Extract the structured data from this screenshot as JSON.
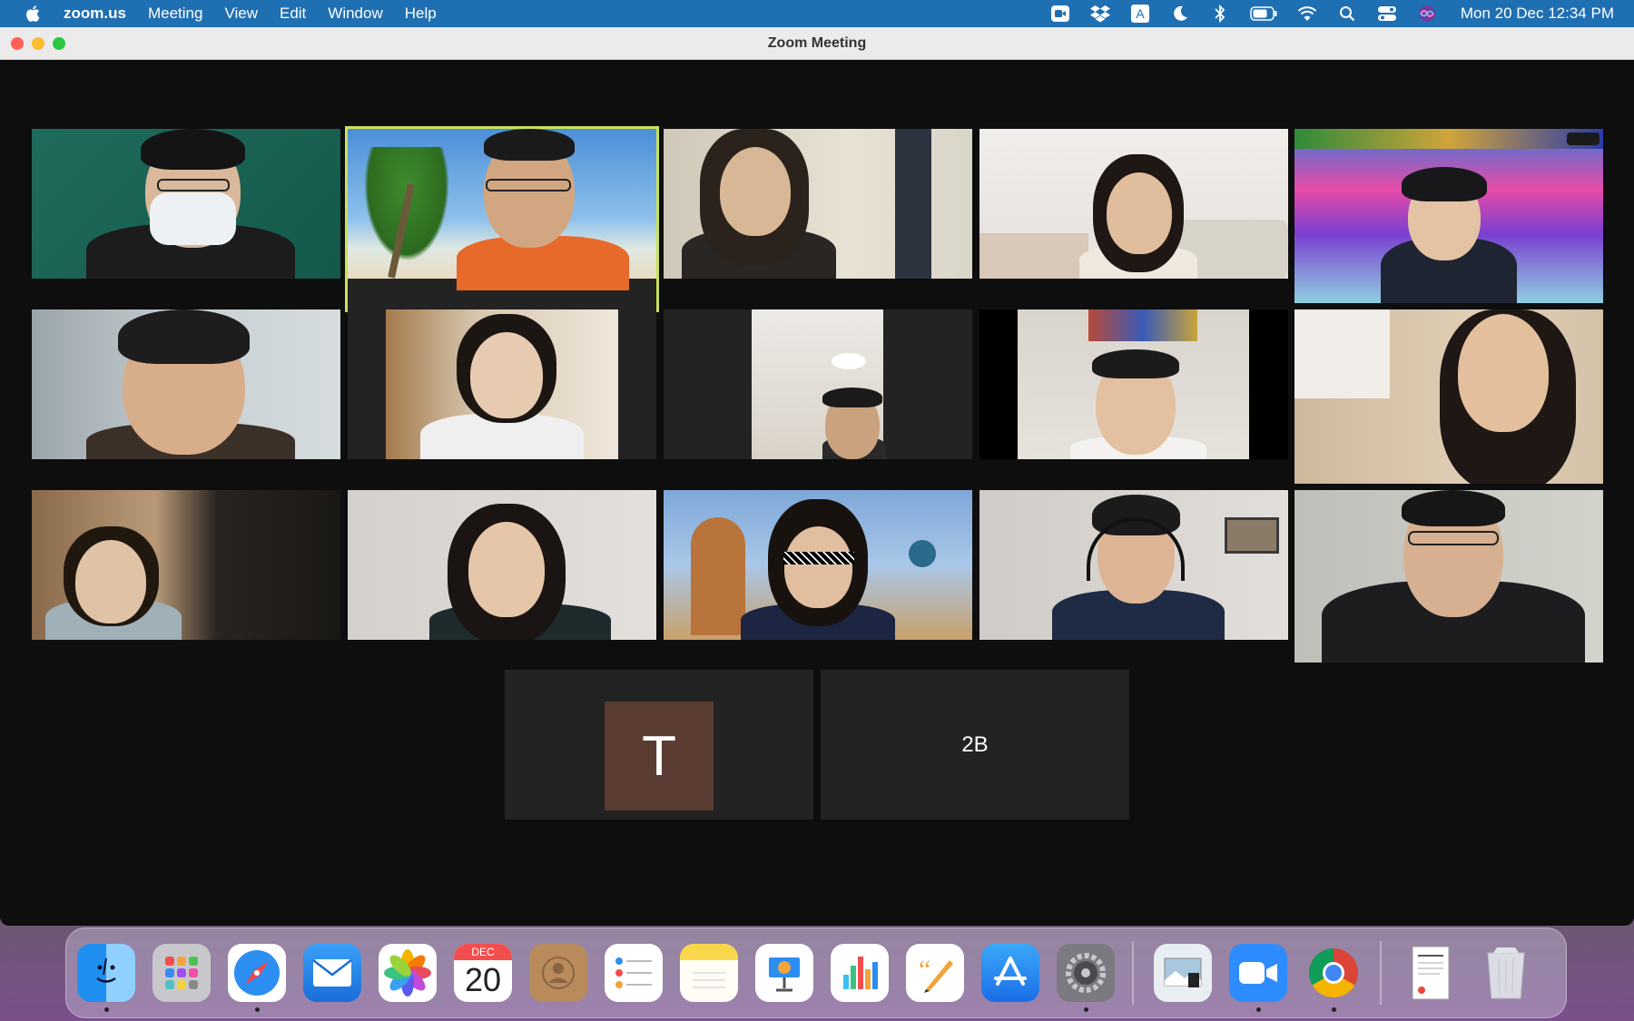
{
  "menubar": {
    "app_name": "zoom.us",
    "items": [
      "Meeting",
      "View",
      "Edit",
      "Window",
      "Help"
    ],
    "clock": "Mon 20 Dec  12:34 PM",
    "status_icons": [
      "zoom-icon",
      "dropbox-icon",
      "input-source-icon",
      "moon-icon",
      "bluetooth-icon",
      "battery-icon",
      "wifi-icon",
      "search-icon",
      "control-center-icon",
      "siri-icon"
    ],
    "input_source_letter": "A"
  },
  "window": {
    "title": "Zoom Meeting"
  },
  "participants": {
    "t_initial": "T",
    "name_2b": "2B"
  },
  "dock": {
    "calendar_month": "DEC",
    "calendar_day": "20",
    "apps": [
      "finder",
      "launchpad",
      "safari",
      "mail",
      "photos",
      "calendar",
      "contacts",
      "reminders",
      "notes",
      "keynote",
      "numbers",
      "pages",
      "app-store",
      "system-preferences",
      "preview",
      "zoom",
      "chrome",
      "document",
      "trash"
    ]
  },
  "colors": {
    "menubar": "#1f6fb3",
    "active_speaker": "#c8e25a",
    "window_bg": "#0e0e0e",
    "tile_bg": "#232323",
    "avatar_t": "#5b3c32"
  }
}
